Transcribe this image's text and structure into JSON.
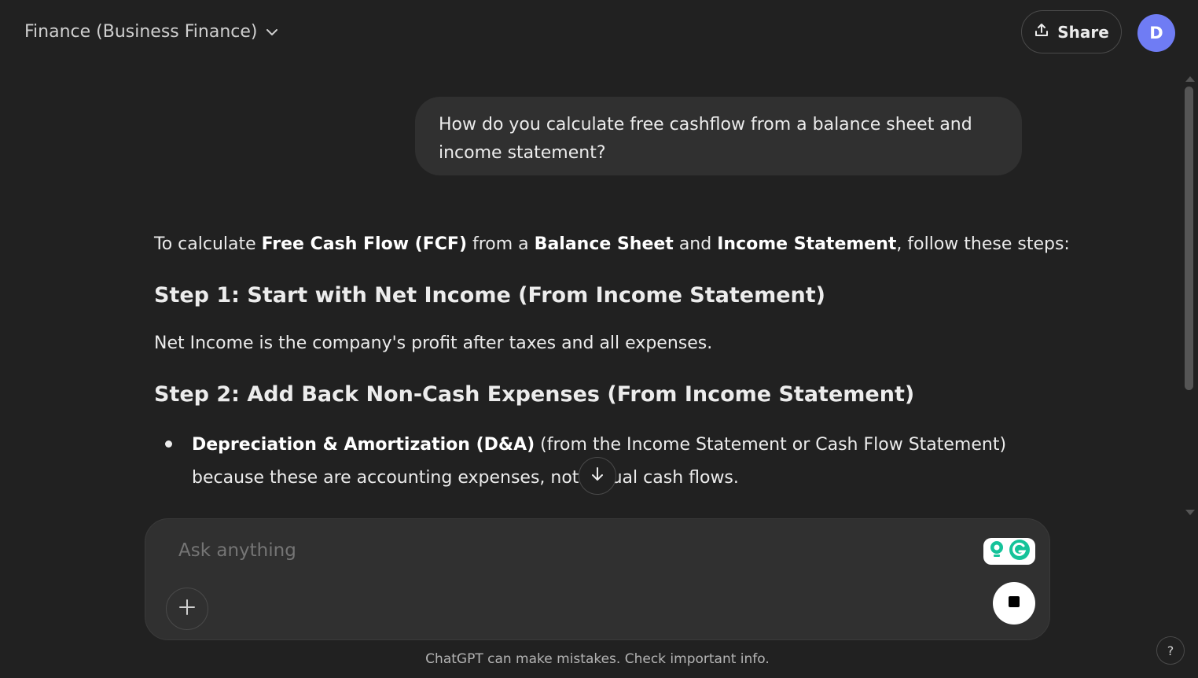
{
  "header": {
    "model_title": "Finance (Business Finance)",
    "share_label": "Share",
    "avatar_initial": "D"
  },
  "conversation": {
    "user_message": "How do you calculate free cashflow from a balance sheet and income statement?",
    "assistant": {
      "intro": {
        "t1": "To calculate ",
        "b1": "Free Cash Flow (FCF)",
        "t2": " from a ",
        "b2": "Balance Sheet",
        "t3": " and ",
        "b3": "Income Statement",
        "t4": ", follow these steps:"
      },
      "step1_heading": "Step 1: Start with Net Income (From Income Statement)",
      "step1_text": "Net Income is the company's profit after taxes and all expenses.",
      "step2_heading": "Step 2: Add Back Non-Cash Expenses (From Income Statement)",
      "step2_bullet": {
        "bold": "Depreciation & Amortization (D&A)",
        "text": " (from the Income Statement or Cash Flow Statement) because these are accounting expenses, not actual cash flows."
      }
    }
  },
  "composer": {
    "placeholder": "Ask anything"
  },
  "footer": {
    "disclaimer": "ChatGPT can make mistakes. Check important info.",
    "help_label": "?"
  },
  "colors": {
    "background": "#212121",
    "bubble": "#303030",
    "avatar": "#6f7cf4",
    "grammarly": "#15c39a"
  }
}
